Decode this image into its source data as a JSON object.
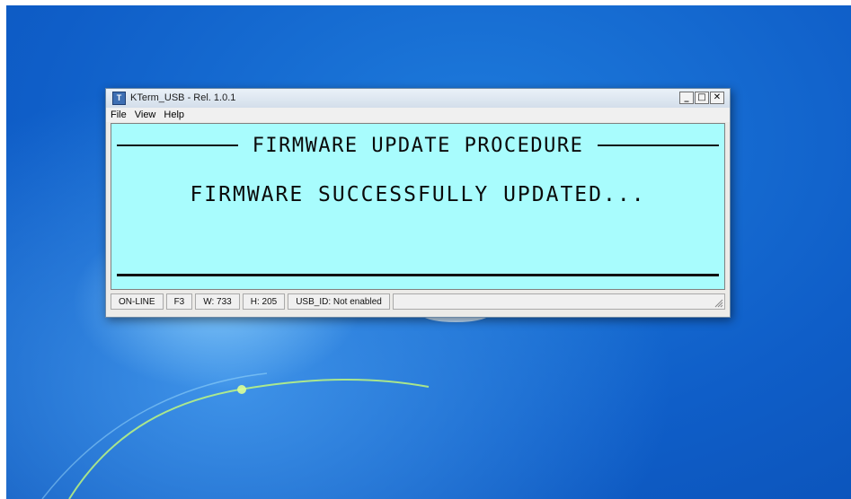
{
  "window": {
    "title": "KTerm_USB - Rel. 1.0.1",
    "icon": "app-icon",
    "buttons": {
      "minimize": "_",
      "maximize": "□",
      "close": "✕"
    }
  },
  "menu": [
    "File",
    "View",
    "Help"
  ],
  "terminal": {
    "header": "FIRMWARE UPDATE PROCEDURE",
    "message": "FIRMWARE SUCCESSFULLY UPDATED...",
    "background_color": "#a8fcfd"
  },
  "status": {
    "mode": "ON-LINE",
    "key": "F3",
    "width": "W: 733",
    "height": "H: 205",
    "usb_id": "USB_ID: Not enabled"
  }
}
